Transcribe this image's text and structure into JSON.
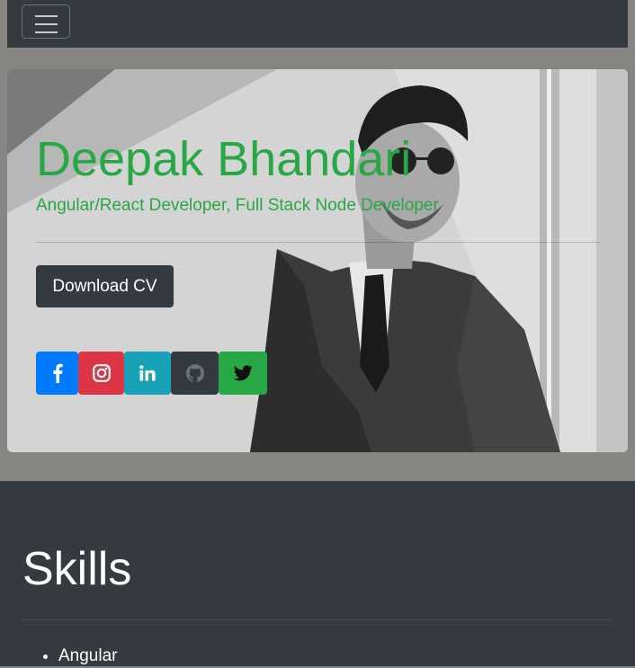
{
  "navbar": {
    "toggle_icon": "menu-icon"
  },
  "hero": {
    "name": "Deepak Bhandari",
    "subtitle": "Angular/React Developer, Full Stack Node Developer",
    "cv_button": "Download CV",
    "photo_icon": "profile-photo"
  },
  "social": [
    {
      "name": "facebook",
      "icon": "facebook-icon",
      "color": "#007bff"
    },
    {
      "name": "instagram",
      "icon": "instagram-icon",
      "color": "#dc3545"
    },
    {
      "name": "linkedin",
      "icon": "linkedin-icon",
      "color": "#17a2b8"
    },
    {
      "name": "github",
      "icon": "github-icon",
      "color": "#343a40"
    },
    {
      "name": "twitter",
      "icon": "twitter-icon",
      "color": "#28a745"
    }
  ],
  "skills": {
    "title": "Skills",
    "items": [
      "Angular"
    ]
  },
  "colors": {
    "accent": "#28a745",
    "dark": "#343a40",
    "page_bg": "#878581"
  }
}
